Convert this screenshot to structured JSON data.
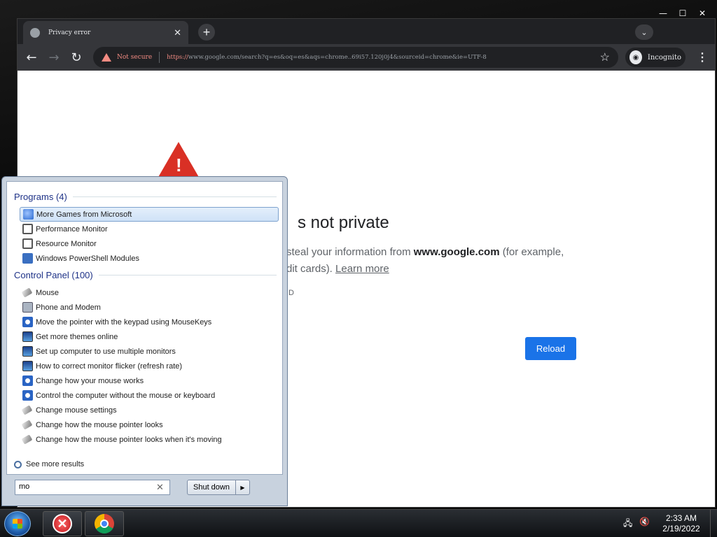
{
  "browser": {
    "tab_title": "Privacy error",
    "tab_close": "✕",
    "new_tab": "+",
    "tab_search": "⌄",
    "not_secure": "Not secure",
    "url_highlight": "https://",
    "url_rest": "www.google.com/search?q=es&oq=es&aqs=chrome..69i57.120j0j4&sourceid=chrome&ie=UTF-8",
    "incognito": "Incognito",
    "window_controls": [
      "—",
      "☐",
      "✕"
    ]
  },
  "error_page": {
    "heading": "s not private",
    "para1_a": "steal your information from ",
    "para1_b": "www.google.com",
    "para1_c": " (for example,",
    "para2_a": "dit cards). ",
    "para2_link": "Learn more",
    "code": "ID",
    "reload": "Reload"
  },
  "start_menu": {
    "programs_header": "Programs (4)",
    "programs": [
      {
        "label": "More Games from Microsoft",
        "icon": "games-icon"
      },
      {
        "label": "Performance Monitor",
        "icon": "perf-icon"
      },
      {
        "label": "Resource Monitor",
        "icon": "perf-icon"
      },
      {
        "label": "Windows PowerShell Modules",
        "icon": "powershell-icon"
      }
    ],
    "control_header": "Control Panel (100)",
    "control": [
      "Mouse",
      "Phone and Modem",
      "Move the pointer with the keypad using MouseKeys",
      "Get more themes online",
      "Set up computer to use multiple monitors",
      "How to correct monitor flicker (refresh rate)",
      "Change how your mouse works",
      "Control the computer without the mouse or keyboard",
      "Change mouse settings",
      "Change how the mouse pointer looks",
      "Change how the mouse pointer looks when it's moving"
    ],
    "see_more": "See more results",
    "search_value": "mo",
    "shutdown": "Shut down"
  },
  "taskbar": {
    "time": "2:33 AM",
    "date": "2/19/2022"
  }
}
